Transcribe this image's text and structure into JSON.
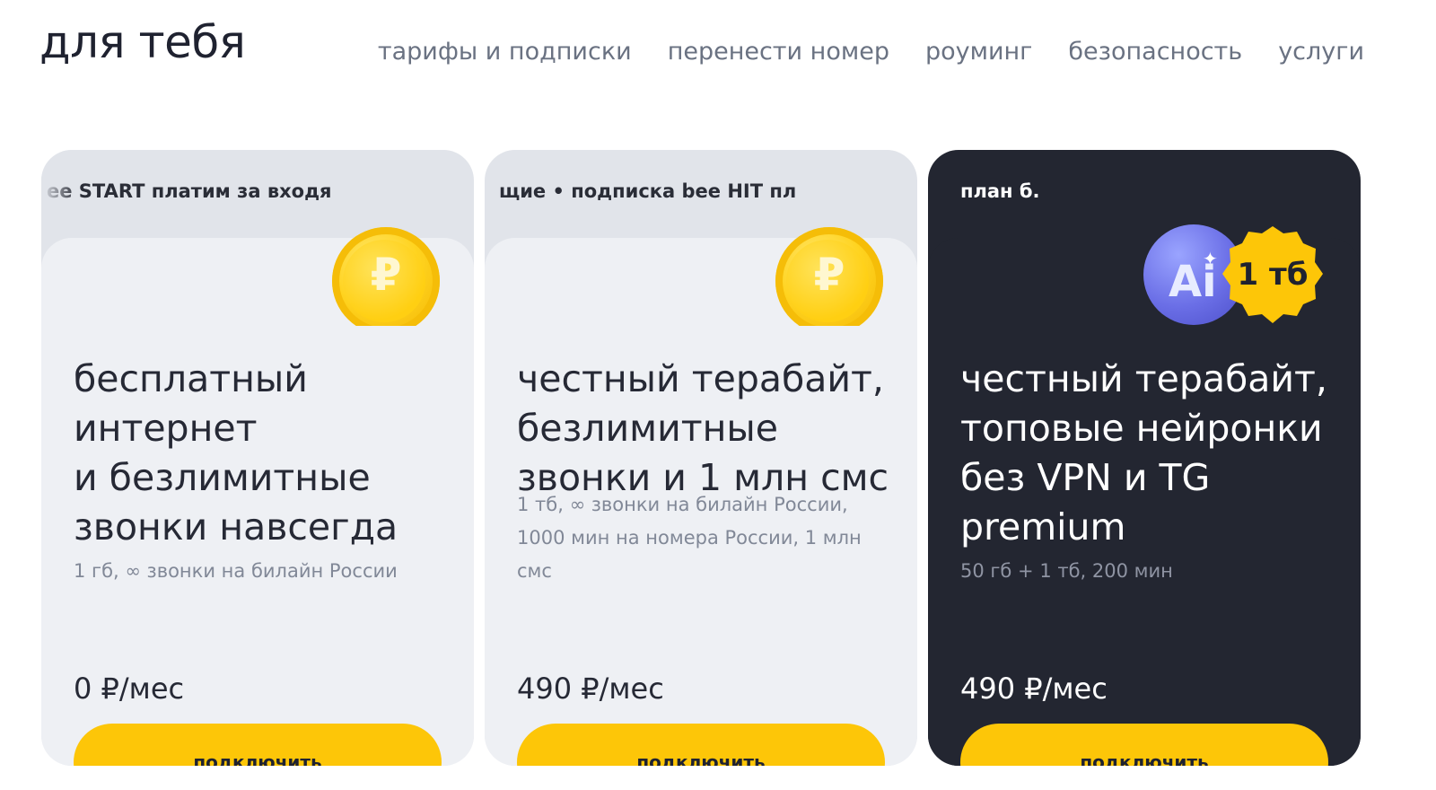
{
  "header": {
    "title": "для тебя",
    "nav": [
      "тарифы и подписки",
      "перенести номер",
      "роуминг",
      "безопасность",
      "услуги"
    ]
  },
  "colors": {
    "accent_yellow": "#fdc608",
    "dark_card": "#232631",
    "light_card": "#eef0f4"
  },
  "cards": [
    {
      "ticker": "ee START  платим за входя",
      "badge_icon": "ruble-coin-icon",
      "badge_symbol": "₽",
      "title": "бесплатный\nинтернет\nи безлимитные\nзвонки навсегда",
      "details": "1 гб, ∞ звонки на билайн России",
      "price": "0 ₽/мес",
      "button": "подключить"
    },
    {
      "ticker": "щие • подписка bee HIT   пл",
      "badge_icon": "ruble-coin-icon",
      "badge_symbol": "₽",
      "title": "честный терабайт,\nбезлимитные\nзвонки и 1 млн смс",
      "details": "1 тб, ∞ звонки на билайн России,\n1000 мин на номера России, 1 млн\nсмс",
      "price": "490 ₽/мес",
      "button": "подключить"
    },
    {
      "label": "план б.",
      "badge_ai": "Ai",
      "badge_ai_spark": "✦",
      "badge_tb": "1 тб",
      "title": "честный терабайт,\nтоповые нейронки\nбез VPN и TG\npremium",
      "details": "50 гб + 1 тб, 200 мин",
      "price": "490 ₽/мес",
      "button": "подключить"
    }
  ]
}
